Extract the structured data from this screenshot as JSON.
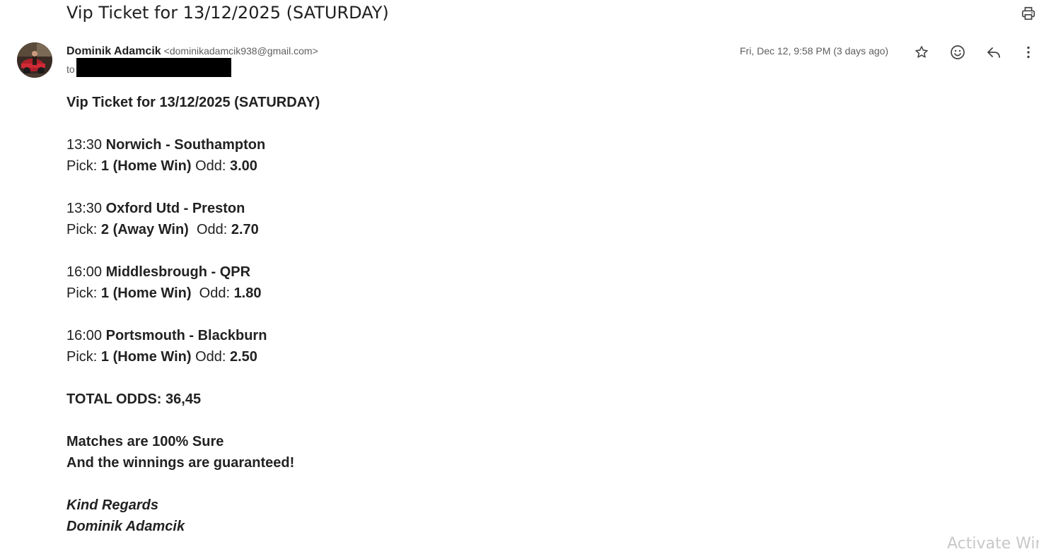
{
  "email": {
    "subject": "Vip Ticket for 13/12/2025 (SATURDAY)",
    "sender_name": "Dominik Adamcik",
    "sender_email": "<dominikadamcik938@gmail.com>",
    "to_label": "to",
    "date": "Fri, Dec 12, 9:58 PM (3 days ago)"
  },
  "icons": {
    "print": "print-icon",
    "star": "star-icon",
    "emoji": "emoji-icon",
    "reply": "reply-icon",
    "more": "more-vertical-icon"
  },
  "body": {
    "heading": "Vip Ticket for 13/12/2025 (SATURDAY)",
    "matches": [
      {
        "time": "13:30",
        "teams": "Norwich - Southampton",
        "pick_label": "Pick:",
        "pick": "1 (Home Win)",
        "odd_label": "Odd:",
        "odd": "3.00"
      },
      {
        "time": "13:30",
        "teams": "Oxford Utd - Preston",
        "pick_label": "Pick:",
        "pick": "2 (Away Win)",
        "odd_label": "Odd:",
        "odd": "2.70"
      },
      {
        "time": "16:00",
        "teams": "Middlesbrough - QPR",
        "pick_label": "Pick:",
        "pick": "1 (Home Win)",
        "odd_label": "Odd:",
        "odd": "1.80"
      },
      {
        "time": "16:00",
        "teams": "Portsmouth - Blackburn",
        "pick_label": "Pick:",
        "pick": "1 (Home Win)",
        "odd_label": "Odd:",
        "odd": "2.50"
      }
    ],
    "total_label": "TOTAL ODDS:",
    "total_value": "36,45",
    "sure_line": "Matches are 100% Sure",
    "guarantee_line": "And the winnings are guaranteed!",
    "regards": "Kind Regards",
    "signature": "Dominik Adamcik"
  },
  "watermark": "Activate Windows"
}
